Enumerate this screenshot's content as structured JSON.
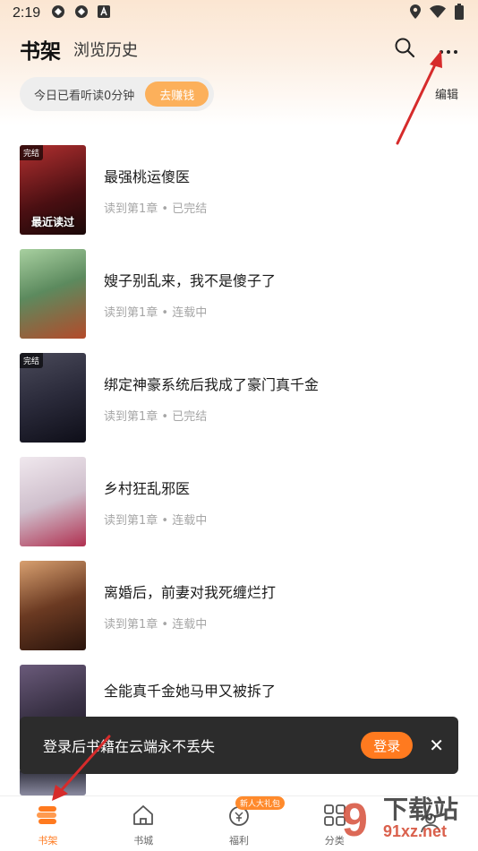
{
  "status_bar": {
    "time": "2:19",
    "icons": [
      "app-icon",
      "app-icon",
      "text-a-icon"
    ],
    "right_icons": [
      "location-icon",
      "wifi-icon",
      "battery-icon"
    ]
  },
  "header": {
    "shelf_tab": "书架",
    "history_tab": "浏览历史",
    "search_icon": "search-icon",
    "more_icon": "more-icon"
  },
  "reading": {
    "text": "今日已看听读0分钟",
    "earn_button": "去赚钱",
    "edit_label": "编辑"
  },
  "books": [
    {
      "title": "最强桃运傻医",
      "progress": "读到第1章 • 已完结",
      "badge": "完结",
      "cover_text": "最近读过",
      "cover_color": "#7a1c1c"
    },
    {
      "title": "嫂子别乱来，我不是傻子了",
      "progress": "读到第1章 • 连载中",
      "badge": "",
      "cover_text": "",
      "cover_color": "#5a8a5c"
    },
    {
      "title": "绑定神豪系统后我成了豪门真千金",
      "progress": "读到第1章 • 已完结",
      "badge": "完结",
      "cover_text": "",
      "cover_color": "#2a2a3a"
    },
    {
      "title": "乡村狂乱邪医",
      "progress": "读到第1章 • 连载中",
      "badge": "",
      "cover_text": "",
      "cover_color": "#c9bfc6"
    },
    {
      "title": "离婚后，前妻对我死缠烂打",
      "progress": "读到第1章 • 连载中",
      "badge": "",
      "cover_text": "",
      "cover_color": "#6b3a22"
    },
    {
      "title": "全能真千金她马甲又被拆了",
      "progress": "",
      "badge": "",
      "cover_text": "",
      "cover_color": "#3a3246"
    }
  ],
  "toast": {
    "text": "登录后书籍在云端永不丢失",
    "login_button": "登录"
  },
  "bottom_nav": [
    {
      "label": "书架",
      "icon": "bookshelf-icon",
      "active": true,
      "badge": ""
    },
    {
      "label": "书城",
      "icon": "home-icon",
      "active": false,
      "badge": ""
    },
    {
      "label": "福利",
      "icon": "coin-icon",
      "active": false,
      "badge": "新人大礼包"
    },
    {
      "label": "分类",
      "icon": "grid-icon",
      "active": false,
      "badge": ""
    },
    {
      "label": "",
      "icon": "profile-icon",
      "active": false,
      "badge": ""
    }
  ],
  "watermark": {
    "title": "下载站",
    "url": "91xz.net"
  },
  "colors": {
    "accent": "#ff7a1f",
    "earn_button": "#fcb05b",
    "annotation": "#d62b2b"
  }
}
